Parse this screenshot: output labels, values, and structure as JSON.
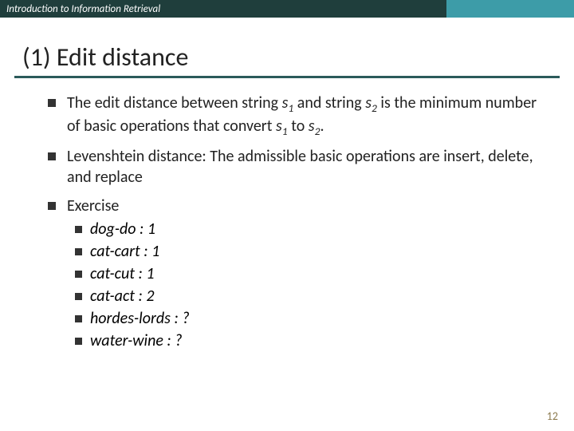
{
  "header": {
    "course": "Introduction to Information Retrieval"
  },
  "title": "(1) Edit distance",
  "bullets": {
    "b1": {
      "pre": "The edit distance between string ",
      "s1": "s",
      "sub1": "1",
      "mid1": " and string ",
      "s2": "s",
      "sub2": "2",
      "mid2": " is the minimum number of basic operations that convert ",
      "s3": "s",
      "sub3": "1",
      "mid3": " to ",
      "s4": "s",
      "sub4": "2",
      "end": "."
    },
    "b2": "Levenshtein distance: The admissible basic operations are insert, delete, and replace",
    "b3": "Exercise",
    "ex": {
      "e1": "dog-do : 1",
      "e2": "cat-cart : 1",
      "e3": "cat-cut : 1",
      "e4": "cat-act : 2",
      "e5": "hordes-lords : ?",
      "e6": "water-wine : ?"
    }
  },
  "page": "12"
}
